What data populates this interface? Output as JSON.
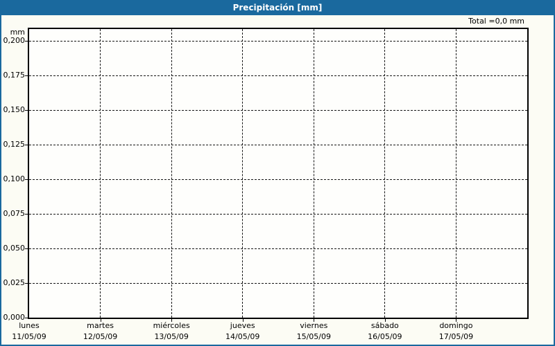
{
  "header": {
    "title": "Precipitación [mm]"
  },
  "summary": {
    "total_label": "Total =0,0 mm"
  },
  "colors": {
    "header_blue": "#1a699e",
    "frame_border": "#1a699e",
    "background": "#fcfcf4",
    "plot_background": "#fefefc",
    "grid": "#141414",
    "title_text": "#ffffff",
    "label_text": "#000000"
  },
  "chart_data": {
    "type": "bar",
    "title": "Precipitación [mm]",
    "ylabel": "mm",
    "unit": "mm",
    "total": "Total =0,0 mm",
    "categories_days": [
      "lunes",
      "martes",
      "miércoles",
      "jueves",
      "viernes",
      "sábado",
      "domingo"
    ],
    "categories_dates": [
      "11/05/09",
      "12/05/09",
      "13/05/09",
      "14/05/09",
      "15/05/09",
      "16/05/09",
      "17/05/09"
    ],
    "values": [
      0,
      0,
      0,
      0,
      0,
      0,
      0
    ],
    "y_ticks": [
      "0,200",
      "0,175",
      "0,150",
      "0,125",
      "0,100",
      "0,075",
      "0,050",
      "0,025",
      "0,000"
    ],
    "y_tick_values": [
      0.2,
      0.175,
      0.15,
      0.125,
      0.1,
      0.075,
      0.05,
      0.025,
      0.0
    ],
    "ylim": [
      0.0,
      0.21
    ],
    "grid": true,
    "grid_style": "dashed",
    "legend_position": "none"
  }
}
